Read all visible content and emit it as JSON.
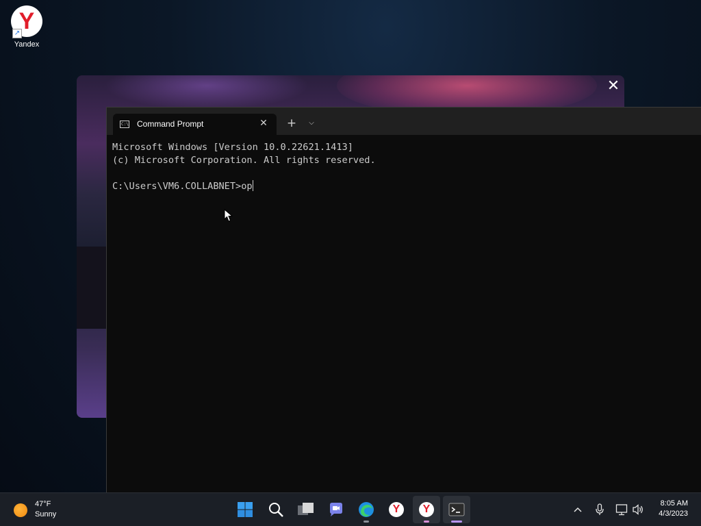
{
  "desktop": {
    "icons": [
      {
        "label": "Yandex",
        "glyph": "Y",
        "icon": "yandex-browser-icon"
      }
    ]
  },
  "snap_preview": {
    "close_glyph": "✕"
  },
  "terminal": {
    "tab": {
      "title": "Command Prompt",
      "icon": "cmd-icon",
      "icon_text": "C:\\",
      "close_glyph": "✕"
    },
    "new_tab_glyph": "+",
    "dropdown_glyph": "⌵",
    "lines": [
      "Microsoft Windows [Version 10.0.22621.1413]",
      "(c) Microsoft Corporation. All rights reserved.",
      "",
      "C:\\Users\\VM6.COLLABNET>op"
    ]
  },
  "taskbar": {
    "weather": {
      "temp": "47°F",
      "condition": "Sunny",
      "icon": "sun-icon"
    },
    "apps": [
      {
        "name": "start",
        "icon": "windows-start-icon"
      },
      {
        "name": "search",
        "icon": "search-icon"
      },
      {
        "name": "task-view",
        "icon": "task-view-icon"
      },
      {
        "name": "teams-chat",
        "icon": "teams-chat-icon"
      },
      {
        "name": "edge",
        "icon": "edge-icon"
      },
      {
        "name": "yandex",
        "icon": "yandex-browser-icon",
        "glyph": "Y"
      },
      {
        "name": "yandex-active",
        "icon": "yandex-browser-icon",
        "glyph": "Y"
      },
      {
        "name": "terminal",
        "icon": "terminal-icon"
      }
    ],
    "tray": {
      "chevron_glyph": "^",
      "mic_icon": "microphone-icon",
      "network_icon": "network-icon",
      "volume_icon": "speaker-icon"
    },
    "clock": {
      "time": "8:05 AM",
      "date": "4/3/2023"
    }
  },
  "colors": {
    "terminal_bg": "#0c0c0c",
    "titlebar_bg": "#202020",
    "taskbar_bg": "#1b1f26",
    "yandex_red": "#e11d2a",
    "edge_blue": "#1e90e0"
  }
}
